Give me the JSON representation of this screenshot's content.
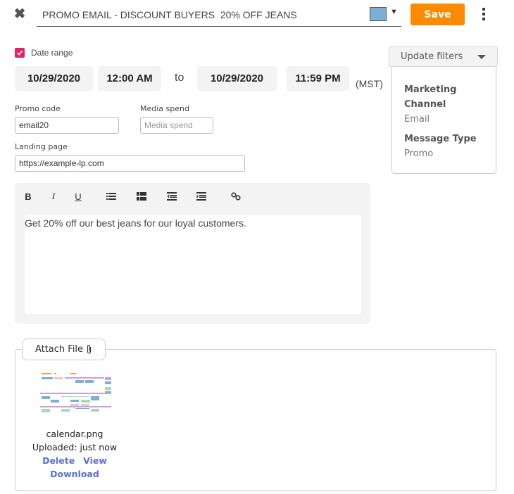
{
  "header": {
    "close_icon": "close-x-icon",
    "title_value": "PROMO EMAIL - DISCOUNT BUYERS  20% OFF JEANS",
    "color_swatch": "#7bafd4",
    "color_caret": "▼",
    "save_label": "Save",
    "save_color": "#ff8a00",
    "more_icon": "vertical-ellipsis-icon"
  },
  "date_range": {
    "label": "Date range",
    "checked": true,
    "checkbox_color": "#e91e63",
    "start_date": "10/29/2020",
    "start_time": "12:00 AM",
    "to_label": "to",
    "end_date": "10/29/2020",
    "end_time": "11:59 PM",
    "timezone": "(MST)"
  },
  "filters": {
    "button_label": "Update filters",
    "items": [
      {
        "heading": "Marketing Channel",
        "value": "Email"
      },
      {
        "heading": "Message Type",
        "value": "Promo"
      }
    ]
  },
  "form": {
    "promo_code_label": "Promo code",
    "promo_code_value": "email20",
    "media_spend_label": "Media spend",
    "media_spend_value": "",
    "media_spend_placeholder": "Media spend",
    "landing_page_label": "Landing page",
    "landing_page_value": "https://example-lp.com"
  },
  "editor": {
    "toolbar": [
      {
        "name": "bold",
        "glyph": "B"
      },
      {
        "name": "italic",
        "glyph": "I"
      },
      {
        "name": "underline",
        "glyph": "U"
      },
      {
        "name": "bulleted-list",
        "glyph": ""
      },
      {
        "name": "numbered-list",
        "glyph": ""
      },
      {
        "name": "outdent",
        "glyph": ""
      },
      {
        "name": "indent",
        "glyph": ""
      },
      {
        "name": "link",
        "glyph": ""
      }
    ],
    "body_text": "Get 20% off our best jeans for our loyal customers."
  },
  "attachment": {
    "attach_label": "Attach File",
    "attach_icon": "paperclip-icon",
    "files": [
      {
        "name": "calendar.png",
        "status": "Uploaded: just now",
        "actions": [
          "Delete",
          "View",
          "Download"
        ]
      }
    ],
    "link_color": "#5b6fd6"
  }
}
